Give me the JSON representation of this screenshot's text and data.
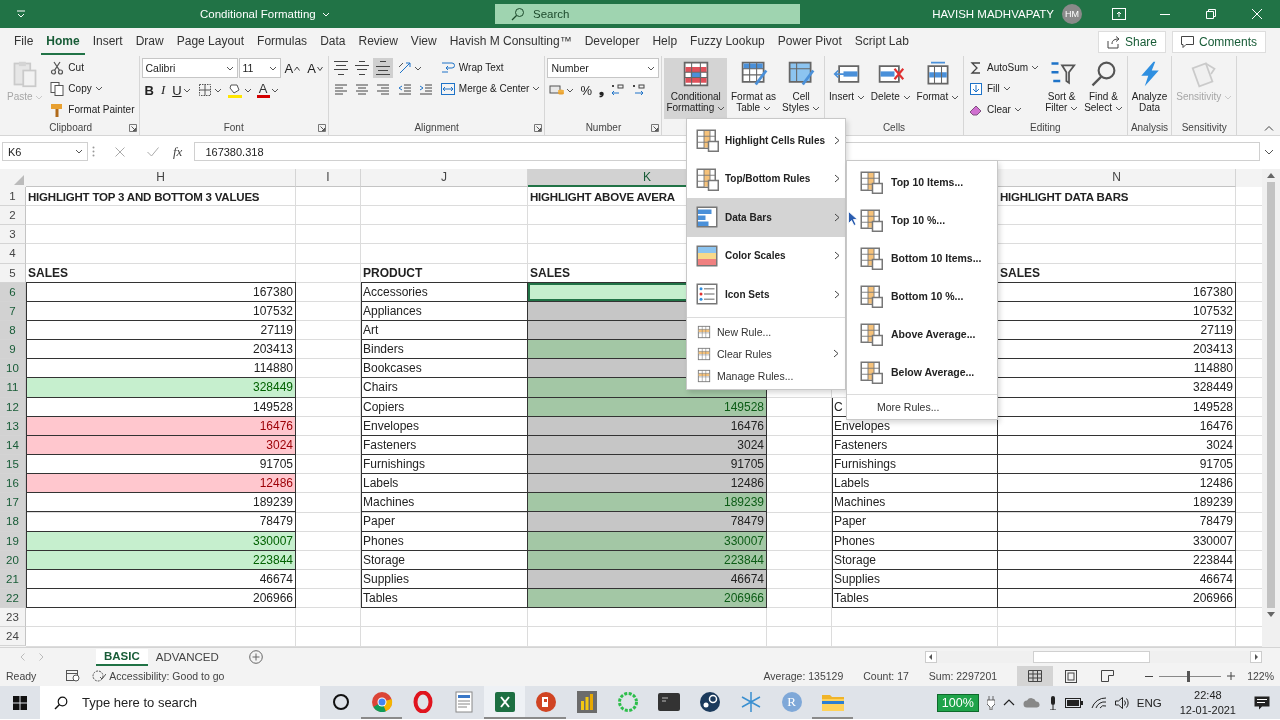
{
  "title_bar": {
    "title": "Conditional Formatting",
    "search": {
      "placeholder": "Search"
    },
    "user": "HAVISH MADHVAPATY",
    "avatar": "HM"
  },
  "ribbon_tabs": [
    {
      "label": "File",
      "selected": false
    },
    {
      "label": "Home",
      "selected": true
    },
    {
      "label": "Insert",
      "selected": false
    },
    {
      "label": "Draw",
      "selected": false
    },
    {
      "label": "Page Layout",
      "selected": false
    },
    {
      "label": "Formulas",
      "selected": false
    },
    {
      "label": "Data",
      "selected": false
    },
    {
      "label": "Review",
      "selected": false
    },
    {
      "label": "View",
      "selected": false
    },
    {
      "label": "Havish M Consulting™",
      "selected": false
    },
    {
      "label": "Developer",
      "selected": false
    },
    {
      "label": "Help",
      "selected": false
    },
    {
      "label": "Fuzzy Lookup",
      "selected": false
    },
    {
      "label": "Power Pivot",
      "selected": false
    },
    {
      "label": "Script Lab",
      "selected": false
    }
  ],
  "share_button": "Share",
  "comments_button": "Comments",
  "ribbon_groups": [
    {
      "label": "Clipboard",
      "launcher": true,
      "stacks": [
        [
          [
            {
              "kind": "paste",
              "label": "Paste",
              "dropdown": true,
              "disabled": true,
              "selected": false
            }
          ]
        ],
        [
          [
            {
              "kind": "cut",
              "label": "Cut",
              "dropdown": false
            }
          ],
          [
            {
              "kind": "copy",
              "label": "Copy",
              "dropdown": true
            }
          ],
          [
            {
              "kind": "format-painter",
              "label": "Format Painter",
              "dropdown": false
            }
          ]
        ]
      ]
    },
    {
      "label": "Font",
      "launcher": true,
      "stacks": [
        [
          [
            {
              "kind": "font-field",
              "value": "Calibri"
            },
            {
              "kind": "size-field",
              "value": "11"
            },
            {
              "kind": "grow-font",
              "text": "A"
            },
            {
              "kind": "shrink-font",
              "text": "A"
            }
          ],
          [
            {
              "kind": "bold",
              "text": "B"
            },
            {
              "kind": "italic",
              "text": "I"
            },
            {
              "kind": "underline",
              "text": "U",
              "dropdown": true
            },
            {
              "kind": "borders",
              "dropdown": true,
              "selected": false
            },
            {
              "kind": "fill-color",
              "dropdown": true,
              "selected": false
            },
            {
              "kind": "font-color",
              "text": "A",
              "dropdown": true
            }
          ]
        ]
      ]
    },
    {
      "label": "Alignment",
      "launcher": true,
      "stacks": [
        [
          [
            {
              "kind": "align-top",
              "selected": false
            },
            {
              "kind": "align-middle",
              "selected": false
            },
            {
              "kind": "align-bottom",
              "selected": true
            }
          ],
          [
            {
              "kind": "align-left",
              "selected": false
            },
            {
              "kind": "align-center",
              "selected": false
            },
            {
              "kind": "align-right",
              "selected": false
            }
          ]
        ],
        [
          [
            {
              "kind": "orientation",
              "dropdown": true,
              "selected": false
            }
          ],
          [
            {
              "kind": "outdent",
              "selected": false
            },
            {
              "kind": "indent",
              "selected": false
            }
          ]
        ],
        [
          [
            {
              "kind": "wrap-text",
              "label": "Wrap Text",
              "dropdown": false
            }
          ],
          [
            {
              "kind": "merge",
              "label": "Merge & Center",
              "dropdown": true
            }
          ]
        ]
      ]
    },
    {
      "label": "Number",
      "launcher": true,
      "stacks": [
        [
          [
            {
              "kind": "number-format",
              "value": "Number"
            }
          ],
          [
            {
              "kind": "accounting",
              "dropdown": true,
              "selected": false
            },
            {
              "kind": "percent",
              "text": "%"
            },
            {
              "kind": "comma",
              "text": "❟"
            },
            {
              "kind": "decimal-up",
              "selected": false
            },
            {
              "kind": "decimal-down",
              "selected": false
            }
          ]
        ]
      ]
    },
    {
      "launcher": false,
      "stacks": [
        [
          [
            {
              "kind": "conditional-formatting",
              "label": "Conditional\nFormatting",
              "dropdown": true,
              "disabled": false,
              "selected": true
            }
          ]
        ],
        [
          [
            {
              "kind": "format-as-table",
              "label": "Format as\nTable",
              "dropdown": true,
              "disabled": false,
              "selected": false
            }
          ]
        ],
        [
          [
            {
              "kind": "cell-styles",
              "label": "Cell\nStyles",
              "dropdown": true,
              "disabled": false,
              "selected": false
            }
          ]
        ]
      ]
    },
    {
      "label": "Cells",
      "launcher": false,
      "stacks": [
        [
          [
            {
              "kind": "insert-cells",
              "label": "Insert",
              "dropdown": true,
              "disabled": false,
              "selected": false
            }
          ]
        ],
        [
          [
            {
              "kind": "delete-cells",
              "label": "Delete",
              "dropdown": true,
              "disabled": false,
              "selected": false
            }
          ]
        ],
        [
          [
            {
              "kind": "format-cells",
              "label": "Format",
              "dropdown": true,
              "disabled": false,
              "selected": false
            }
          ]
        ]
      ]
    },
    {
      "label": "Editing",
      "launcher": false,
      "stacks": [
        [
          [
            {
              "kind": "autosum",
              "label": "AutoSum",
              "dropdown": true
            }
          ],
          [
            {
              "kind": "fill-down",
              "label": "Fill",
              "dropdown": true
            }
          ],
          [
            {
              "kind": "clear",
              "label": "Clear",
              "dropdown": true
            }
          ]
        ],
        [
          [
            {
              "kind": "sort-filter",
              "label": "Sort &\nFilter",
              "dropdown": true,
              "disabled": false,
              "selected": false
            }
          ]
        ],
        [
          [
            {
              "kind": "find-select",
              "label": "Find &\nSelect",
              "dropdown": true,
              "disabled": false,
              "selected": false
            }
          ]
        ]
      ]
    },
    {
      "label": "Analysis",
      "launcher": false,
      "stacks": [
        [
          [
            {
              "kind": "analyze",
              "label": "Analyze\nData",
              "dropdown": false,
              "disabled": false,
              "selected": false
            }
          ]
        ]
      ]
    },
    {
      "label": "Sensitivity",
      "launcher": false,
      "stacks": [
        [
          [
            {
              "kind": "sensitivity",
              "label": "Sensitivity",
              "dropdown": true,
              "disabled": true,
              "selected": false
            }
          ]
        ]
      ]
    }
  ],
  "formula_bar": {
    "name_box": "K6",
    "fx": "fx",
    "value": "167380.318"
  },
  "columns": {
    "h": {
      "label": "H",
      "selected": false
    },
    "i": {
      "label": "I",
      "selected": false
    },
    "j": {
      "label": "J",
      "selected": false
    },
    "k": {
      "label": "K",
      "selected": true
    },
    "n": {
      "label": "N",
      "selected": false
    }
  },
  "rows": [
    {
      "number": "1",
      "selected": false,
      "h": {
        "text": "HIGHLIGHT TOP 3 AND BOTTOM 3 VALUES",
        "kind": "title"
      },
      "k": {
        "text": "HIGHLIGHT ABOVE AVERA",
        "kind": "title"
      },
      "n": {
        "text": "HIGHLIGHT DATA BARS",
        "kind": "title"
      }
    },
    {
      "number": "2",
      "selected": false
    },
    {
      "number": "3",
      "selected": false
    },
    {
      "number": "4",
      "selected": false
    },
    {
      "number": "5",
      "selected": false,
      "h": {
        "text": "SALES",
        "kind": "heading"
      },
      "j": {
        "text": "PRODUCT",
        "kind": "heading"
      },
      "k": {
        "text": "SALES",
        "kind": "heading"
      },
      "n": {
        "text": "SALES",
        "kind": "heading"
      }
    },
    {
      "number": "6",
      "selected": true,
      "h": {
        "text": "167380",
        "kind": "number",
        "top_three": false,
        "bottom_three": false
      },
      "j": {
        "text": "Accessories",
        "kind": "text"
      },
      "k": {
        "kind": "number",
        "above_average": true,
        "active": true
      },
      "n": {
        "text": "167380",
        "kind": "number"
      }
    },
    {
      "number": "7",
      "selected": true,
      "h": {
        "text": "107532",
        "kind": "number",
        "top_three": false,
        "bottom_three": false
      },
      "j": {
        "text": "Appliances",
        "kind": "text"
      },
      "k": {
        "kind": "number",
        "above_average": false,
        "selected": true,
        "active": false
      },
      "n": {
        "text": "107532",
        "kind": "number"
      }
    },
    {
      "number": "8",
      "selected": true,
      "h": {
        "text": "27119",
        "kind": "number",
        "top_three": false,
        "bottom_three": false
      },
      "j": {
        "text": "Art",
        "kind": "text"
      },
      "k": {
        "kind": "number",
        "above_average": false,
        "selected": true,
        "active": false
      },
      "n": {
        "text": "27119",
        "kind": "number"
      }
    },
    {
      "number": "9",
      "selected": true,
      "h": {
        "text": "203413",
        "kind": "number",
        "top_three": false,
        "bottom_three": false
      },
      "j": {
        "text": "Binders",
        "kind": "text"
      },
      "k": {
        "kind": "number",
        "above_average": true,
        "selected": true,
        "active": false
      },
      "n": {
        "text": "203413",
        "kind": "number"
      }
    },
    {
      "number": "10",
      "selected": true,
      "h": {
        "text": "114880",
        "kind": "number",
        "top_three": false,
        "bottom_three": false
      },
      "j": {
        "text": "Bookcases",
        "kind": "text"
      },
      "k": {
        "kind": "number",
        "above_average": false,
        "selected": true,
        "active": false
      },
      "n": {
        "text": "114880",
        "kind": "number"
      }
    },
    {
      "number": "11",
      "selected": true,
      "h": {
        "text": "328449",
        "kind": "number",
        "top_three": true,
        "bottom_three": false
      },
      "j": {
        "text": "Chairs",
        "kind": "text"
      },
      "k": {
        "kind": "number",
        "above_average": true,
        "selected": true,
        "active": false
      },
      "n": {
        "text": "328449",
        "kind": "number"
      }
    },
    {
      "number": "12",
      "selected": true,
      "h": {
        "text": "149528",
        "kind": "number",
        "top_three": false,
        "bottom_three": false
      },
      "j": {
        "text": "Copiers",
        "kind": "text"
      },
      "k": {
        "text": "149528",
        "kind": "number",
        "above_average": true,
        "selected": true,
        "active": false
      },
      "m": {
        "text": "C",
        "kind": "text"
      },
      "n": {
        "text": "149528",
        "kind": "number"
      }
    },
    {
      "number": "13",
      "selected": true,
      "h": {
        "text": "16476",
        "kind": "number",
        "top_three": false,
        "bottom_three": true
      },
      "j": {
        "text": "Envelopes",
        "kind": "text"
      },
      "k": {
        "text": "16476",
        "kind": "number",
        "above_average": false,
        "selected": true,
        "active": false
      },
      "m": {
        "text": "Envelopes",
        "kind": "text"
      },
      "n": {
        "text": "16476",
        "kind": "number"
      }
    },
    {
      "number": "14",
      "selected": true,
      "h": {
        "text": "3024",
        "kind": "number",
        "top_three": false,
        "bottom_three": true
      },
      "j": {
        "text": "Fasteners",
        "kind": "text"
      },
      "k": {
        "text": "3024",
        "kind": "number",
        "above_average": false,
        "selected": true,
        "active": false
      },
      "m": {
        "text": "Fasteners",
        "kind": "text"
      },
      "n": {
        "text": "3024",
        "kind": "number"
      }
    },
    {
      "number": "15",
      "selected": true,
      "h": {
        "text": "91705",
        "kind": "number",
        "top_three": false,
        "bottom_three": false
      },
      "j": {
        "text": "Furnishings",
        "kind": "text"
      },
      "k": {
        "text": "91705",
        "kind": "number",
        "above_average": false,
        "selected": true,
        "active": false
      },
      "m": {
        "text": "Furnishings",
        "kind": "text"
      },
      "n": {
        "text": "91705",
        "kind": "number"
      }
    },
    {
      "number": "16",
      "selected": true,
      "h": {
        "text": "12486",
        "kind": "number",
        "top_three": false,
        "bottom_three": true
      },
      "j": {
        "text": "Labels",
        "kind": "text"
      },
      "k": {
        "text": "12486",
        "kind": "number",
        "above_average": false,
        "selected": true,
        "active": false
      },
      "m": {
        "text": "Labels",
        "kind": "text"
      },
      "n": {
        "text": "12486",
        "kind": "number"
      }
    },
    {
      "number": "17",
      "selected": true,
      "h": {
        "text": "189239",
        "kind": "number",
        "top_three": false,
        "bottom_three": false
      },
      "j": {
        "text": "Machines",
        "kind": "text"
      },
      "k": {
        "text": "189239",
        "kind": "number",
        "above_average": true,
        "selected": true,
        "active": false
      },
      "m": {
        "text": "Machines",
        "kind": "text"
      },
      "n": {
        "text": "189239",
        "kind": "number"
      }
    },
    {
      "number": "18",
      "selected": true,
      "h": {
        "text": "78479",
        "kind": "number",
        "top_three": false,
        "bottom_three": false
      },
      "j": {
        "text": "Paper",
        "kind": "text"
      },
      "k": {
        "text": "78479",
        "kind": "number",
        "above_average": false,
        "selected": true,
        "active": false
      },
      "m": {
        "text": "Paper",
        "kind": "text"
      },
      "n": {
        "text": "78479",
        "kind": "number"
      }
    },
    {
      "number": "19",
      "selected": true,
      "h": {
        "text": "330007",
        "kind": "number",
        "top_three": true,
        "bottom_three": false
      },
      "j": {
        "text": "Phones",
        "kind": "text"
      },
      "k": {
        "text": "330007",
        "kind": "number",
        "above_average": true,
        "selected": true,
        "active": false
      },
      "m": {
        "text": "Phones",
        "kind": "text"
      },
      "n": {
        "text": "330007",
        "kind": "number"
      }
    },
    {
      "number": "20",
      "selected": true,
      "h": {
        "text": "223844",
        "kind": "number",
        "top_three": true,
        "bottom_three": false
      },
      "j": {
        "text": "Storage",
        "kind": "text"
      },
      "k": {
        "text": "223844",
        "kind": "number",
        "above_average": true,
        "selected": true,
        "active": false
      },
      "m": {
        "text": "Storage",
        "kind": "text"
      },
      "n": {
        "text": "223844",
        "kind": "number"
      }
    },
    {
      "number": "21",
      "selected": true,
      "h": {
        "text": "46674",
        "kind": "number",
        "top_three": false,
        "bottom_three": false
      },
      "j": {
        "text": "Supplies",
        "kind": "text"
      },
      "k": {
        "text": "46674",
        "kind": "number",
        "above_average": false,
        "selected": true,
        "active": false
      },
      "m": {
        "text": "Supplies",
        "kind": "text"
      },
      "n": {
        "text": "46674",
        "kind": "number"
      }
    },
    {
      "number": "22",
      "selected": true,
      "h": {
        "text": "206966",
        "kind": "number",
        "top_three": false,
        "bottom_three": false
      },
      "j": {
        "text": "Tables",
        "kind": "text"
      },
      "k": {
        "text": "206966",
        "kind": "number",
        "above_average": true,
        "selected": true,
        "active": false
      },
      "m": {
        "text": "Tables",
        "kind": "text"
      },
      "n": {
        "text": "206966",
        "kind": "number"
      }
    },
    {
      "number": "23",
      "selected": false
    },
    {
      "number": "24",
      "selected": false
    }
  ],
  "cf_menu": {
    "items": [
      {
        "kind": "highlight-rules",
        "label": "Highlight Cells Rules",
        "submenu": true,
        "selected": false
      },
      {
        "kind": "top-bottom",
        "label": "Top/Bottom Rules",
        "submenu": true,
        "selected": false
      },
      {
        "kind": "data-bars",
        "label": "Data Bars",
        "submenu": true,
        "selected": true
      },
      {
        "kind": "color-scales",
        "label": "Color Scales",
        "submenu": true,
        "selected": false
      },
      {
        "kind": "icon-sets",
        "label": "Icon Sets",
        "submenu": true,
        "selected": false
      },
      {
        "kind": "rule",
        "label": "New Rule...",
        "submenu": false,
        "selected": false
      },
      {
        "kind": "rule",
        "label": "Clear Rules",
        "submenu": true,
        "selected": false
      },
      {
        "kind": "rule",
        "label": "Manage Rules...",
        "submenu": false,
        "selected": false
      }
    ]
  },
  "submenu": {
    "items": [
      {
        "label": "Top 10 Items..."
      },
      {
        "label": "Top 10 %..."
      },
      {
        "label": "Bottom 10 Items..."
      },
      {
        "label": "Bottom 10 %..."
      },
      {
        "label": "Above Average..."
      },
      {
        "label": "Below Average..."
      }
    ],
    "more": "More Rules..."
  },
  "sheet_tabs": [
    {
      "label": "BASIC",
      "selected": true
    },
    {
      "label": "ADVANCED",
      "selected": false
    }
  ],
  "status_bar": {
    "status": "Ready",
    "accessibility": "Accessibility: Good to go",
    "stats": [
      "Average: 135129",
      "Count: 17",
      "Sum: 2297201"
    ],
    "views": [
      {
        "kind": "normal",
        "selected": true
      },
      {
        "kind": "page-layout",
        "selected": false
      },
      {
        "kind": "page-break",
        "selected": false
      }
    ],
    "zoom": {
      "level": 0.47,
      "text": "122%"
    }
  },
  "taskbar": {
    "search": {
      "placeholder": "Type here to search"
    },
    "apps": [
      {
        "kind": "cortana",
        "running": false,
        "selected": false
      },
      {
        "kind": "chrome",
        "running": true,
        "selected": false
      },
      {
        "kind": "opera",
        "running": false,
        "selected": false
      },
      {
        "kind": "notes",
        "running": false,
        "selected": false
      },
      {
        "kind": "excel",
        "running": true,
        "selected": true
      },
      {
        "kind": "powerpoint",
        "running": true,
        "selected": false
      },
      {
        "kind": "powerbi",
        "running": false,
        "selected": false
      },
      {
        "kind": "ring",
        "running": false,
        "selected": false
      },
      {
        "kind": "terminal",
        "running": false,
        "selected": false
      },
      {
        "kind": "steam",
        "running": false,
        "selected": false
      },
      {
        "kind": "snowflake",
        "running": false,
        "selected": false
      },
      {
        "kind": "r",
        "text": "R",
        "running": false,
        "selected": false
      },
      {
        "kind": "folder",
        "running": true,
        "selected": false
      }
    ],
    "battery": "100%",
    "language": "ENG",
    "time": "22:48",
    "date": "12-01-2021"
  }
}
